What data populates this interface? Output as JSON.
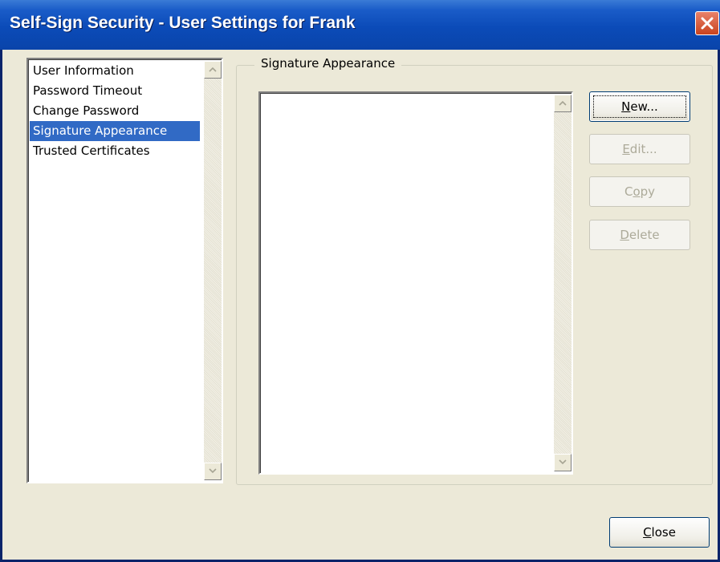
{
  "window": {
    "title": "Self-Sign Security - User Settings for Frank"
  },
  "sidebar": {
    "items": [
      {
        "label": "User Information",
        "selected": false
      },
      {
        "label": "Password Timeout",
        "selected": false
      },
      {
        "label": "Change Password",
        "selected": false
      },
      {
        "label": "Signature Appearance",
        "selected": true
      },
      {
        "label": "Trusted Certificates",
        "selected": false
      }
    ]
  },
  "panel": {
    "group_title": "Signature Appearance",
    "signature_list": []
  },
  "buttons": {
    "new": {
      "mnemonic": "N",
      "rest": "ew...",
      "enabled": true
    },
    "edit": {
      "mnemonic": "E",
      "rest": "dit...",
      "enabled": false
    },
    "copy": {
      "pre": "C",
      "mnemonic": "o",
      "rest": "py",
      "enabled": false
    },
    "delete": {
      "mnemonic": "D",
      "rest": "elete",
      "enabled": false
    },
    "close": {
      "mnemonic": "C",
      "rest": "lose",
      "enabled": true
    }
  },
  "colors": {
    "titlebar": "#0b4bb8",
    "dialog_bg": "#ece9d8",
    "selection": "#316ac5",
    "close_button": "#c9431e"
  }
}
